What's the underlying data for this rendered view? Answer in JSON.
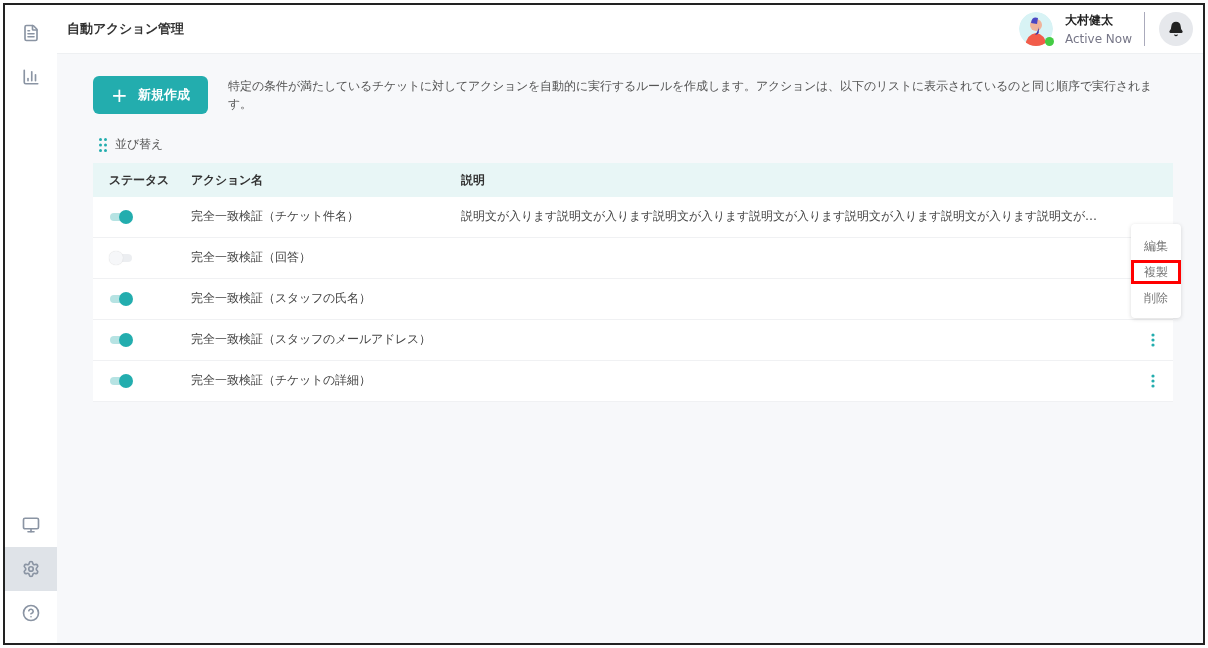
{
  "sidebar": {
    "items": [
      {
        "selected": false
      },
      {
        "selected": false
      },
      {
        "selected": false
      },
      {
        "selected": true
      },
      {
        "selected": false
      }
    ]
  },
  "header": {
    "title": "自動アクション管理",
    "user": {
      "name": "大村健太",
      "status": "Active Now",
      "online": true
    }
  },
  "toolbar": {
    "new_button": {
      "icon": "+",
      "label": "新規作成"
    },
    "description": "特定の条件が満たしているチケットに対してアクションを自動的に実行するルールを作成します。アクションは、以下のリストに表示されているのと同じ順序で実行されます。"
  },
  "sort_link": "並び替え",
  "table": {
    "columns": [
      "ステータス",
      "アクション名",
      "説明"
    ],
    "rows": [
      {
        "on": true,
        "name": "完全一致検証（チケット件名）",
        "description": "説明文が入ります説明文が入ります説明文が入ります説明文が入ります説明文が入ります説明文が入ります説明文が…",
        "menu_button": false
      },
      {
        "on": false,
        "name": "完全一致検証（回答）",
        "menu_button": false
      },
      {
        "on": true,
        "name": "完全一致検証（スタッフの氏名）",
        "menu_button": false
      },
      {
        "on": true,
        "name": "完全一致検証（スタッフのメールアドレス）",
        "menu_button": true
      },
      {
        "on": true,
        "name": "完全一致検証（チケットの詳細）",
        "menu_button": true
      }
    ]
  },
  "row_menu": {
    "items": [
      {
        "label": "編集",
        "highlighted": false
      },
      {
        "label": "複製",
        "highlighted": true
      },
      {
        "label": "削除",
        "highlighted": false
      }
    ]
  }
}
